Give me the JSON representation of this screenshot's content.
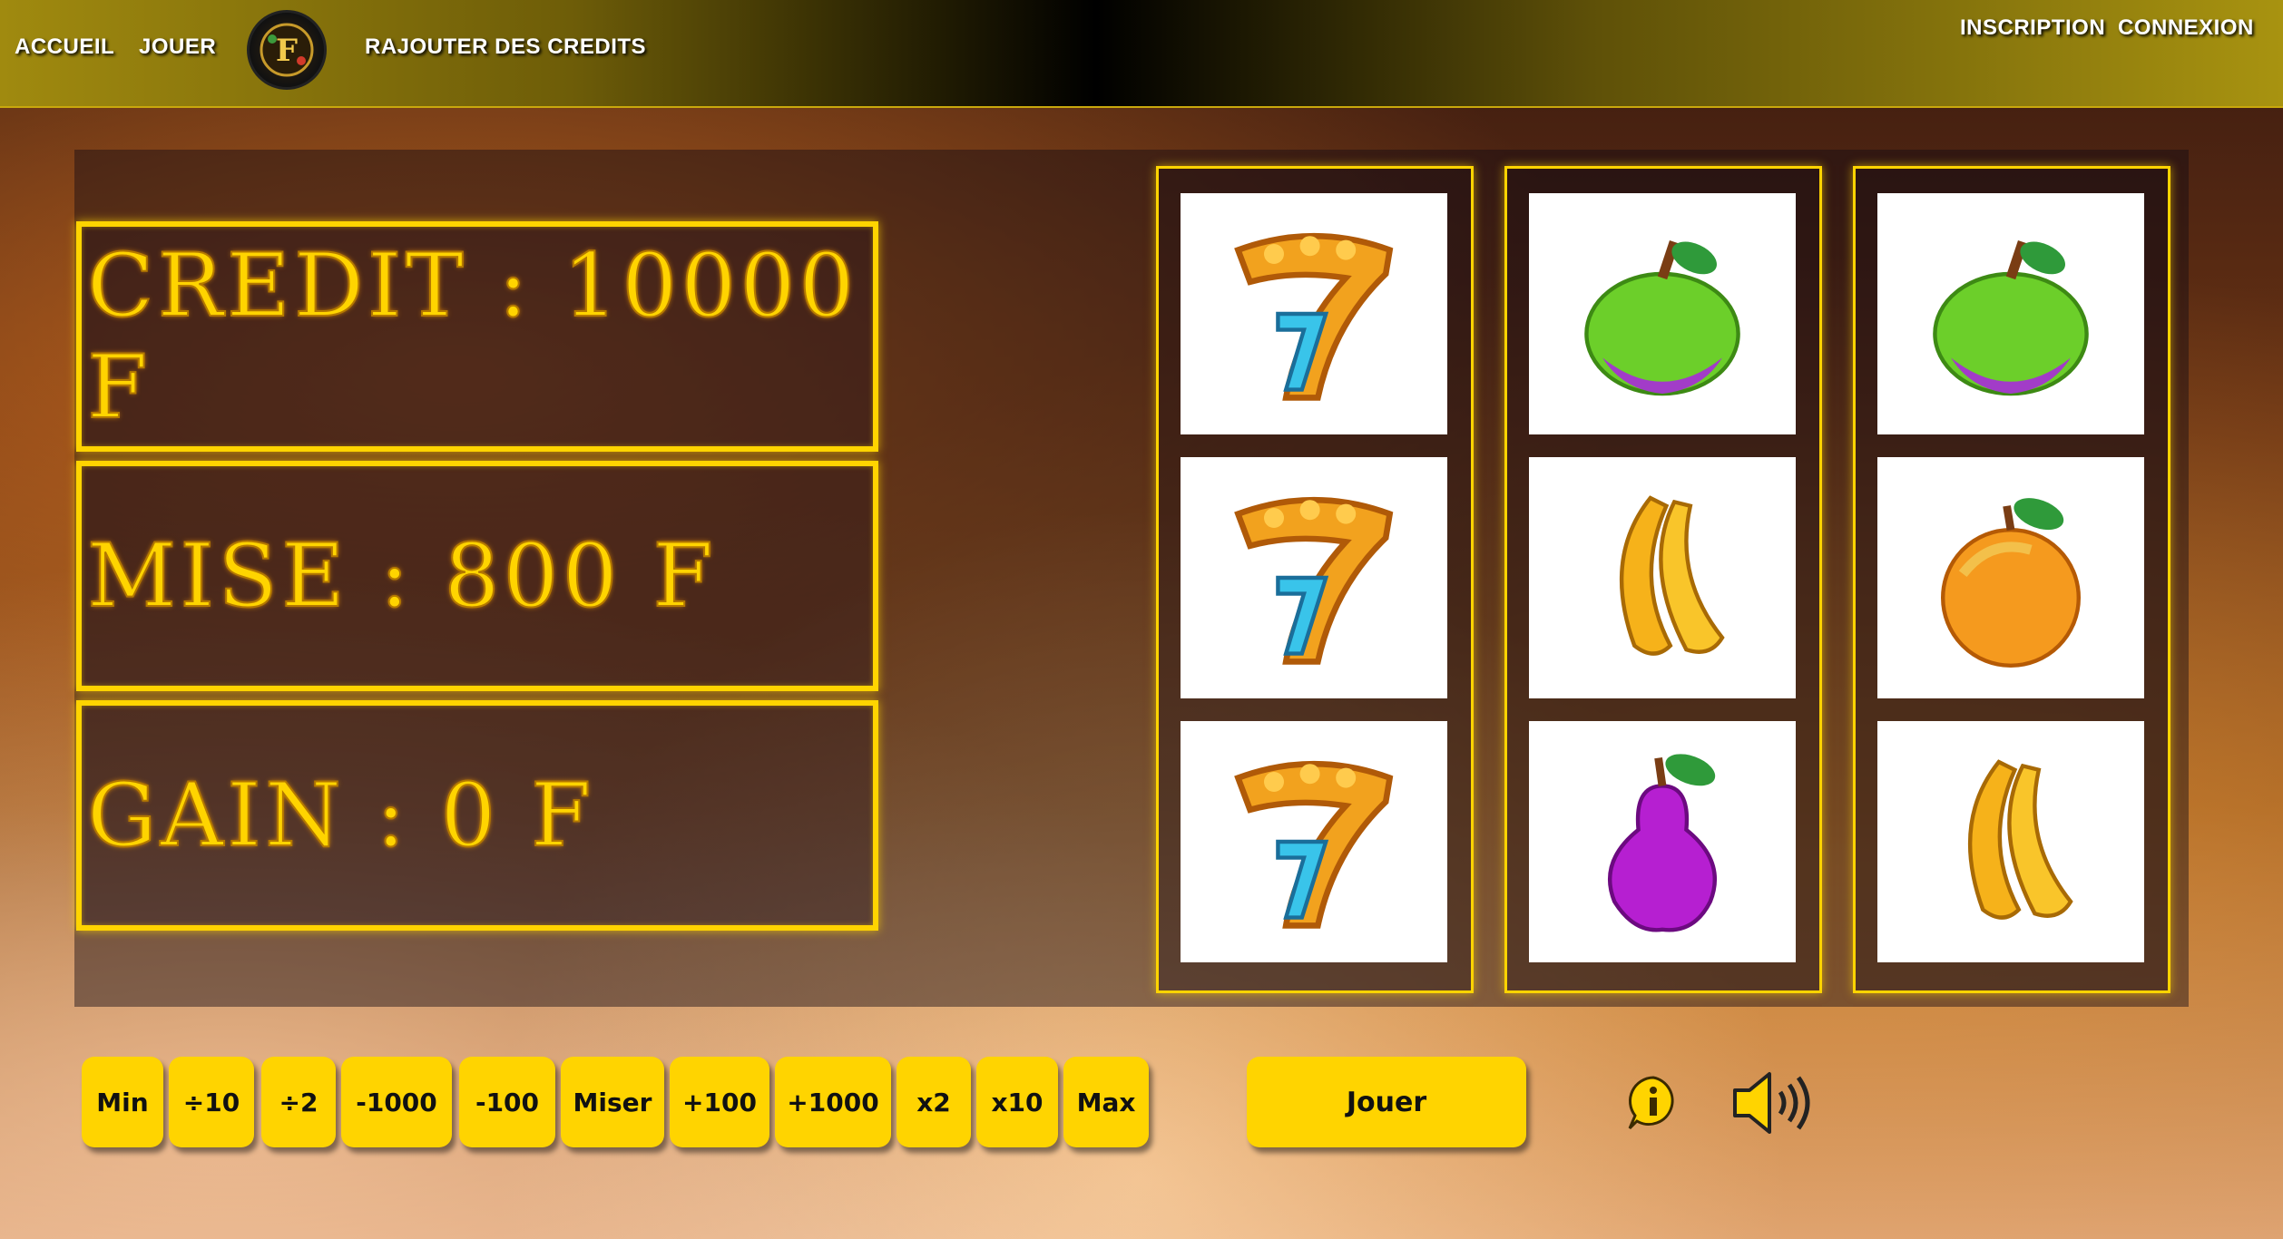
{
  "nav": {
    "home": "ACCUEIL",
    "play": "JOUER",
    "add_credits": "RAJOUTER DES CREDITS",
    "signup": "INSCRIPTION",
    "login": "CONNEXION",
    "logo_letter": "F"
  },
  "stats": {
    "credit": "CREDIT : 10000 F",
    "bet": "MISE : 800 F",
    "gain": "GAIN : 0 F"
  },
  "reels": [
    [
      "seven-icon",
      "seven-icon",
      "seven-icon"
    ],
    [
      "apple-icon",
      "banana-icon",
      "pear-icon"
    ],
    [
      "apple-icon",
      "peach-icon",
      "banana-icon"
    ]
  ],
  "controls": {
    "min": "Min",
    "div10": "÷10",
    "div2": "÷2",
    "minus1000": "-1000",
    "minus100": "-100",
    "bet": "Miser",
    "plus100": "+100",
    "plus1000": "+1000",
    "x2": "x2",
    "x10": "x10",
    "max": "Max",
    "play": "Jouer"
  },
  "colors": {
    "accent": "#ffd400",
    "nav_gold": "#a08a0f"
  }
}
